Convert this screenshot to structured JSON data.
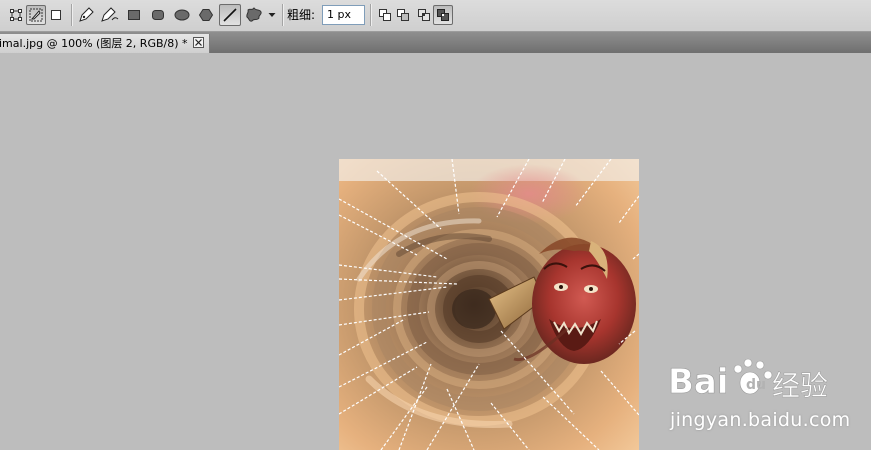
{
  "options_bar": {
    "tools": [
      {
        "name": "shape-layers-icon",
        "active": false
      },
      {
        "name": "paths-icon",
        "active": true
      },
      {
        "name": "fill-pixels-icon",
        "active": false
      },
      {
        "name": "pen-icon",
        "active": false
      },
      {
        "name": "freeform-pen-icon",
        "active": false
      },
      {
        "name": "rectangle-icon",
        "active": false
      },
      {
        "name": "rounded-rectangle-icon",
        "active": false
      },
      {
        "name": "ellipse-icon",
        "active": false
      },
      {
        "name": "polygon-icon",
        "active": false
      },
      {
        "name": "line-icon",
        "active": true
      },
      {
        "name": "custom-shape-icon",
        "active": false
      }
    ],
    "weight_label": "粗细:",
    "weight_value": "1 px",
    "path_ops": [
      "add-to-path-icon",
      "subtract-from-path-icon",
      "intersect-path-icon",
      "exclude-overlap-icon"
    ]
  },
  "document_tab": {
    "label": "imal.jpg @ 100% (图层 2, RGB/8) *"
  },
  "watermark": {
    "logo_text": "Baidu经验",
    "url": "jingyan.baidu.com"
  }
}
